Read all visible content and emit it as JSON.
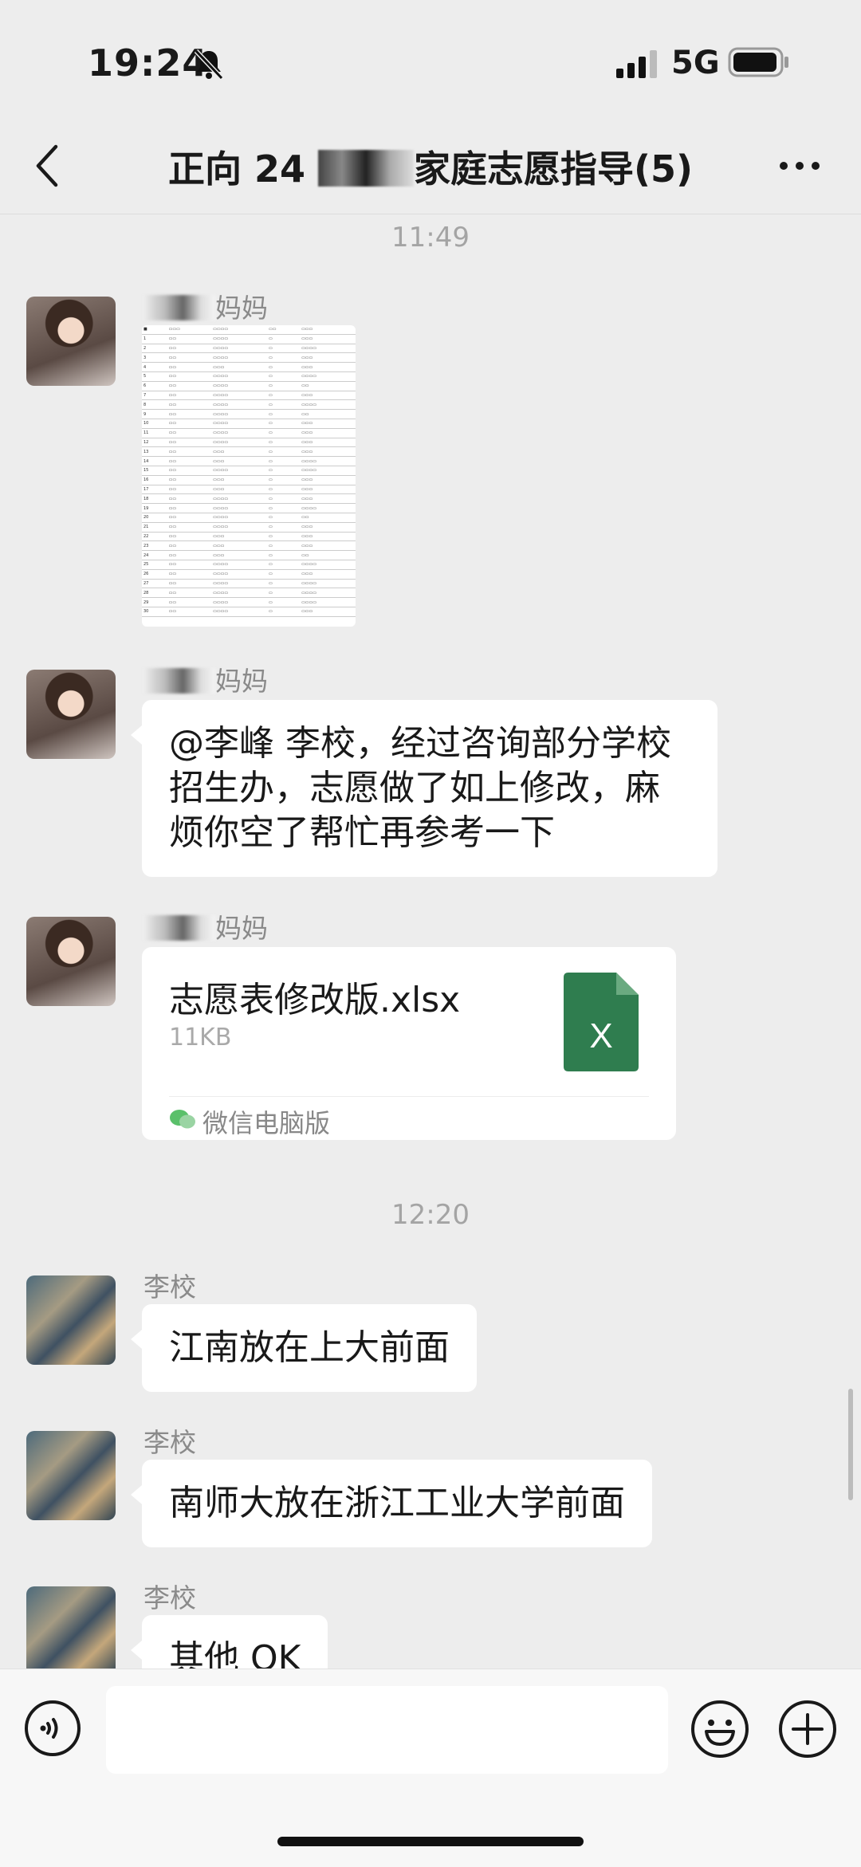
{
  "status_bar": {
    "time": "19:24",
    "network": "5G"
  },
  "header": {
    "title_prefix": "正向 24 ",
    "title_suffix": "家庭志愿指导(5)"
  },
  "messages": {
    "ts1": "11:49",
    "m1": {
      "sender_suffix": "妈妈"
    },
    "m2": {
      "sender_suffix": "妈妈",
      "text": "@李峰 李校，经过咨询部分学校招生办，志愿做了如上修改，麻烦你空了帮忙再参考一下"
    },
    "m3": {
      "sender_suffix": "妈妈",
      "file_name": "志愿表修改版.xlsx",
      "file_size": "11KB",
      "source": "微信电脑版",
      "file_icon_letter": "X"
    },
    "ts2": "12:20",
    "m4": {
      "sender": "李校",
      "text": "江南放在上大前面"
    },
    "m5": {
      "sender": "李校",
      "text": "南师大放在浙江工业大学前面"
    },
    "m6": {
      "sender": "李校",
      "text": "其他 OK"
    }
  },
  "colors": {
    "background": "#ededed",
    "excel_green": "#2f7d4f",
    "bubble": "#ffffff"
  }
}
